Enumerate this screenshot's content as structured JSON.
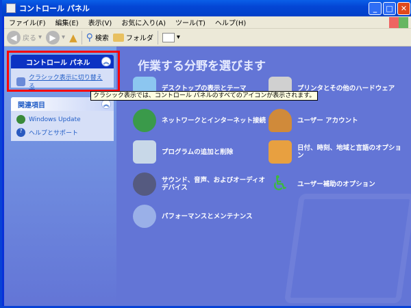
{
  "window": {
    "title": "コントロール パネル",
    "min": "_",
    "max": "□",
    "close": "✕"
  },
  "menu": [
    "ファイル(F)",
    "編集(E)",
    "表示(V)",
    "お気に入り(A)",
    "ツール(T)",
    "ヘルプ(H)"
  ],
  "toolbar": {
    "back": "戻る",
    "search": "検索",
    "folders": "フォルダ"
  },
  "left": {
    "cp_header": "コントロール パネル",
    "switch_link": "クラシック表示に切り替える",
    "related_header": "関連項目",
    "related": [
      "Windows Update",
      "ヘルプとサポート"
    ]
  },
  "main": {
    "title": "作業する分野を選びます",
    "categories": [
      {
        "label": "デスクトップの表示とテーマ",
        "icon": "palette-icon",
        "color": "#8cc6f0"
      },
      {
        "label": "プリンタとその他のハードウェア",
        "icon": "printer-icon",
        "color": "#d0d0d0"
      },
      {
        "label": "ネットワークとインターネット接続",
        "icon": "network-globe-icon",
        "color": "#3a9a4a"
      },
      {
        "label": "ユーザー アカウント",
        "icon": "users-icon",
        "color": "#d08a3a"
      },
      {
        "label": "プログラムの追加と削除",
        "icon": "cd-box-icon",
        "color": "#c8d8e8"
      },
      {
        "label": "日付、時刻、地域と言語のオプション",
        "icon": "calendar-globe-icon",
        "color": "#e8a040"
      },
      {
        "label": "サウンド、音声、およびオーディオ デバイス",
        "icon": "speaker-icon",
        "color": "#555a80"
      },
      {
        "label": "ユーザー補助のオプション",
        "icon": "accessibility-icon",
        "color": "#3cba3c"
      },
      {
        "label": "パフォーマンスとメンテナンス",
        "icon": "pie-chart-icon",
        "color": "#9ab0e8"
      }
    ]
  },
  "tooltip": "クラシック表示では、コントロール パネルのすべてのアイコンが表示されます。"
}
